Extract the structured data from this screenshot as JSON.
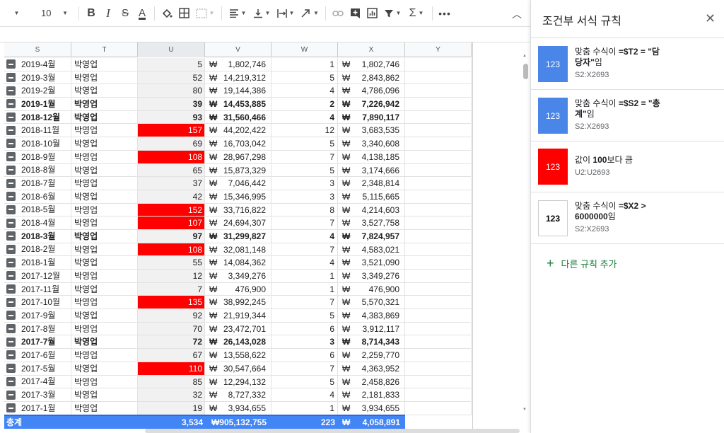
{
  "toolbar": {
    "font_size": "10",
    "icons": [
      "caret-down",
      "bold",
      "italic",
      "strikethrough",
      "text-color",
      "fill-color",
      "borders",
      "merge",
      "align-horizontal",
      "align-vertical",
      "text-wrap",
      "text-rotation",
      "link",
      "comment",
      "chart",
      "filter",
      "functions",
      "more"
    ]
  },
  "columns": [
    "S",
    "T",
    "U",
    "V",
    "W",
    "X",
    "Y"
  ],
  "currency": "₩",
  "rows": [
    {
      "month": "2019-4월",
      "name": "박영업",
      "u": "5",
      "v": "1,802,746",
      "w": "1",
      "x": "1,802,746",
      "bold": false,
      "red": false
    },
    {
      "month": "2019-3월",
      "name": "박영업",
      "u": "52",
      "v": "14,219,312",
      "w": "5",
      "x": "2,843,862",
      "bold": false,
      "red": false
    },
    {
      "month": "2019-2월",
      "name": "박영업",
      "u": "80",
      "v": "19,144,386",
      "w": "4",
      "x": "4,786,096",
      "bold": false,
      "red": false
    },
    {
      "month": "2019-1월",
      "name": "박영업",
      "u": "39",
      "v": "14,453,885",
      "w": "2",
      "x": "7,226,942",
      "bold": true,
      "red": false
    },
    {
      "month": "2018-12월",
      "name": "박영업",
      "u": "93",
      "v": "31,560,466",
      "w": "4",
      "x": "7,890,117",
      "bold": true,
      "red": false
    },
    {
      "month": "2018-11월",
      "name": "박영업",
      "u": "157",
      "v": "44,202,422",
      "w": "12",
      "x": "3,683,535",
      "bold": false,
      "red": true
    },
    {
      "month": "2018-10월",
      "name": "박영업",
      "u": "69",
      "v": "16,703,042",
      "w": "5",
      "x": "3,340,608",
      "bold": false,
      "red": false
    },
    {
      "month": "2018-9월",
      "name": "박영업",
      "u": "108",
      "v": "28,967,298",
      "w": "7",
      "x": "4,138,185",
      "bold": false,
      "red": true
    },
    {
      "month": "2018-8월",
      "name": "박영업",
      "u": "65",
      "v": "15,873,329",
      "w": "5",
      "x": "3,174,666",
      "bold": false,
      "red": false
    },
    {
      "month": "2018-7월",
      "name": "박영업",
      "u": "37",
      "v": "7,046,442",
      "w": "3",
      "x": "2,348,814",
      "bold": false,
      "red": false
    },
    {
      "month": "2018-6월",
      "name": "박영업",
      "u": "42",
      "v": "15,346,995",
      "w": "3",
      "x": "5,115,665",
      "bold": false,
      "red": false
    },
    {
      "month": "2018-5월",
      "name": "박영업",
      "u": "152",
      "v": "33,716,822",
      "w": "8",
      "x": "4,214,603",
      "bold": false,
      "red": true
    },
    {
      "month": "2018-4월",
      "name": "박영업",
      "u": "107",
      "v": "24,694,307",
      "w": "7",
      "x": "3,527,758",
      "bold": false,
      "red": true
    },
    {
      "month": "2018-3월",
      "name": "박영업",
      "u": "97",
      "v": "31,299,827",
      "w": "4",
      "x": "7,824,957",
      "bold": true,
      "red": false
    },
    {
      "month": "2018-2월",
      "name": "박영업",
      "u": "108",
      "v": "32,081,148",
      "w": "7",
      "x": "4,583,021",
      "bold": false,
      "red": true
    },
    {
      "month": "2018-1월",
      "name": "박영업",
      "u": "55",
      "v": "14,084,362",
      "w": "4",
      "x": "3,521,090",
      "bold": false,
      "red": false
    },
    {
      "month": "2017-12월",
      "name": "박영업",
      "u": "12",
      "v": "3,349,276",
      "w": "1",
      "x": "3,349,276",
      "bold": false,
      "red": false
    },
    {
      "month": "2017-11월",
      "name": "박영업",
      "u": "7",
      "v": "476,900",
      "w": "1",
      "x": "476,900",
      "bold": false,
      "red": false
    },
    {
      "month": "2017-10월",
      "name": "박영업",
      "u": "135",
      "v": "38,992,245",
      "w": "7",
      "x": "5,570,321",
      "bold": false,
      "red": true
    },
    {
      "month": "2017-9월",
      "name": "박영업",
      "u": "92",
      "v": "21,919,344",
      "w": "5",
      "x": "4,383,869",
      "bold": false,
      "red": false
    },
    {
      "month": "2017-8월",
      "name": "박영업",
      "u": "70",
      "v": "23,472,701",
      "w": "6",
      "x": "3,912,117",
      "bold": false,
      "red": false
    },
    {
      "month": "2017-7월",
      "name": "박영업",
      "u": "72",
      "v": "26,143,028",
      "w": "3",
      "x": "8,714,343",
      "bold": true,
      "red": false
    },
    {
      "month": "2017-6월",
      "name": "박영업",
      "u": "67",
      "v": "13,558,622",
      "w": "6",
      "x": "2,259,770",
      "bold": false,
      "red": false
    },
    {
      "month": "2017-5월",
      "name": "박영업",
      "u": "110",
      "v": "30,547,664",
      "w": "7",
      "x": "4,363,952",
      "bold": false,
      "red": true
    },
    {
      "month": "2017-4월",
      "name": "박영업",
      "u": "85",
      "v": "12,294,132",
      "w": "5",
      "x": "2,458,826",
      "bold": false,
      "red": false
    },
    {
      "month": "2017-3월",
      "name": "박영업",
      "u": "32",
      "v": "8,727,332",
      "w": "4",
      "x": "2,181,833",
      "bold": false,
      "red": false
    },
    {
      "month": "2017-1월",
      "name": "박영업",
      "u": "19",
      "v": "3,934,655",
      "w": "1",
      "x": "3,934,655",
      "bold": false,
      "red": false
    }
  ],
  "total": {
    "label": "총계",
    "u": "3,534",
    "v": "₩905,132,755",
    "w": "223",
    "x": "4,058,891"
  },
  "panel": {
    "title": "조건부 서식 규칙",
    "rules": [
      {
        "swatch": "123",
        "style": "blue",
        "line1": "맞춤 수식이 ",
        "bold1": "=$T2 = \"담",
        "line2": "당자\"",
        "tail2": "임",
        "range": "S2:X2693"
      },
      {
        "swatch": "123",
        "style": "blue",
        "line1": "맞춤 수식이 ",
        "bold1": "=$S2 = \"총",
        "line2": "계\"",
        "tail2": "임",
        "range": "S2:X2693"
      },
      {
        "swatch": "123",
        "style": "red",
        "line1": "값이 ",
        "bold1": "100",
        "line2": "",
        "tail2": "보다 큼",
        "range": "U2:U2693"
      },
      {
        "swatch": "123",
        "style": "white",
        "line1": "맞춤 수식이 ",
        "bold1": "=$X2 >",
        "line2": "6000000",
        "tail2": "임",
        "range": "S2:X2693"
      }
    ],
    "add_rule": "다른 규칙 추가"
  },
  "colors": {
    "accent": "#4285f4",
    "red": "#ff0000",
    "rule_blue": "#4a86e8",
    "green": "#188038"
  }
}
